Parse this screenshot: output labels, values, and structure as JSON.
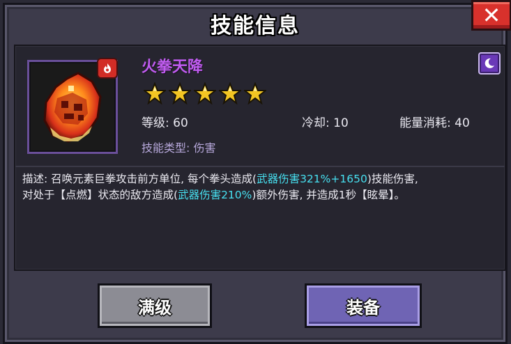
{
  "dialog": {
    "title": "技能信息",
    "close_label": "✕"
  },
  "skill": {
    "name": "火拳天降",
    "icon": "flaming-fist-icon",
    "element_badge": "fire-icon",
    "rarity_badge": "moon-icon",
    "stars": 5,
    "level_label": "等级: 60",
    "cooldown_label": "冷却: 10",
    "energy_label": "能量消耗: 40",
    "type_label": "技能类型: 伤害"
  },
  "description": {
    "line1_prefix": "描述: 召唤元素巨拳攻击前方单位, 每个拳头造成(",
    "line1_highlight": "武器伤害321%+1650",
    "line1_suffix": ")技能伤害,",
    "line2_prefix": "对处于【点燃】状态的敌方造成(",
    "line2_highlight": "武器伤害210%",
    "line2_suffix": ")额外伤害, 并造成1秒【眩晕】。"
  },
  "buttons": {
    "max_level": "满级",
    "equip": "装备"
  },
  "colors": {
    "skill_name": "#c05cf0",
    "highlight": "#47e0f0",
    "star": "#f3c623",
    "close_button": "#d8312c",
    "equip_button": "#6f64b4",
    "max_button": "#8c8c94"
  }
}
